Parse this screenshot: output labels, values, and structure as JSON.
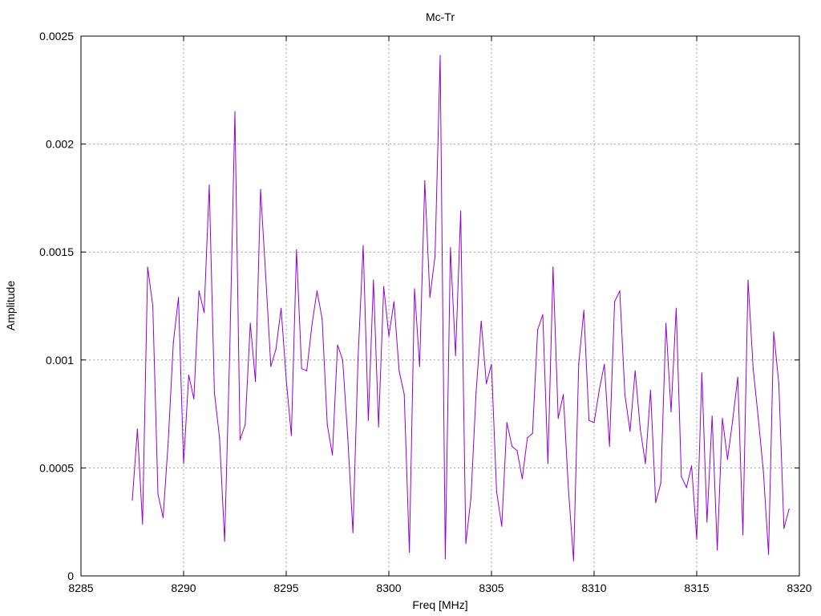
{
  "chart_data": {
    "type": "line",
    "title": "Mc-Tr",
    "xlabel": "Freq [MHz]",
    "ylabel": "Amplitude",
    "xlim": [
      8285,
      8320
    ],
    "ylim": [
      0,
      0.0025
    ],
    "grid": true,
    "xticks": [
      8285,
      8290,
      8295,
      8300,
      8305,
      8310,
      8315,
      8320
    ],
    "yticks": [
      0,
      0.0005,
      0.001,
      0.0015,
      0.002,
      0.0025
    ],
    "xtick_labels": [
      "8285",
      "8290",
      "8295",
      "8300",
      "8305",
      "8310",
      "8315",
      "8320"
    ],
    "ytick_labels": [
      "0",
      "0.0005",
      "0.001",
      "0.0015",
      "0.002",
      "0.0025"
    ],
    "line_color": "#9400d3",
    "series": [
      {
        "x": [
          8287.5,
          8287.75,
          8288.0,
          8288.25,
          8288.5,
          8288.75,
          8289.0,
          8289.25,
          8289.5,
          8289.75,
          8290.0,
          8290.25,
          8290.5,
          8290.75,
          8291.0,
          8291.25,
          8291.5,
          8291.75,
          8292.0,
          8292.25,
          8292.5,
          8292.75,
          8293.0,
          8293.25,
          8293.5,
          8293.75,
          8294.0,
          8294.25,
          8294.5,
          8294.75,
          8295.0,
          8295.25,
          8295.5,
          8295.75,
          8296.0,
          8296.25,
          8296.5,
          8296.75,
          8297.0,
          8297.25,
          8297.5,
          8297.75,
          8298.0,
          8298.25,
          8298.5,
          8298.75,
          8299.0,
          8299.25,
          8299.5,
          8299.75,
          8300.0,
          8300.25,
          8300.5,
          8300.75,
          8301.0,
          8301.25,
          8301.5,
          8301.75,
          8302.0,
          8302.25,
          8302.5,
          8302.75,
          8303.0,
          8303.25,
          8303.5,
          8303.75,
          8304.0,
          8304.25,
          8304.5,
          8304.75,
          8305.0,
          8305.25,
          8305.5,
          8305.75,
          8306.0,
          8306.25,
          8306.5,
          8306.75,
          8307.0,
          8307.25,
          8307.5,
          8307.75,
          8308.0,
          8308.25,
          8308.5,
          8308.75,
          8309.0,
          8309.25,
          8309.5,
          8309.75,
          8310.0,
          8310.25,
          8310.5,
          8310.75,
          8311.0,
          8311.25,
          8311.5,
          8311.75,
          8312.0,
          8312.25,
          8312.5,
          8312.75,
          8313.0,
          8313.25,
          8313.5,
          8313.75,
          8314.0,
          8314.25,
          8314.5,
          8314.75,
          8315.0,
          8315.25,
          8315.5,
          8315.75,
          8316.0,
          8316.25,
          8316.5,
          8316.75,
          8317.0,
          8317.25,
          8317.5,
          8317.75,
          8318.0,
          8318.25,
          8318.5,
          8318.75,
          8319.0,
          8319.25,
          8319.5
        ],
        "y": [
          0.00035,
          0.00068,
          0.00024,
          0.00143,
          0.00125,
          0.00038,
          0.00027,
          0.00062,
          0.00108,
          0.00129,
          0.00052,
          0.00093,
          0.00082,
          0.00132,
          0.00122,
          0.00181,
          0.00085,
          0.00064,
          0.00016,
          0.00105,
          0.00215,
          0.00063,
          0.0007,
          0.00117,
          0.0009,
          0.00179,
          0.00139,
          0.00097,
          0.00105,
          0.00124,
          0.00091,
          0.00065,
          0.00151,
          0.00096,
          0.00095,
          0.00116,
          0.00132,
          0.00119,
          0.0007,
          0.00056,
          0.00107,
          0.001,
          0.00064,
          0.0002,
          0.00101,
          0.00153,
          0.00072,
          0.00137,
          0.00069,
          0.00134,
          0.00111,
          0.00127,
          0.00095,
          0.00084,
          0.00011,
          0.00133,
          0.00097,
          0.00183,
          0.00129,
          0.00148,
          0.00241,
          8e-05,
          0.00152,
          0.00102,
          0.00169,
          0.00015,
          0.00036,
          0.00085,
          0.00118,
          0.00089,
          0.00098,
          0.00039,
          0.00023,
          0.00071,
          0.0006,
          0.00058,
          0.00045,
          0.00064,
          0.00066,
          0.00114,
          0.00121,
          0.00052,
          0.00143,
          0.00073,
          0.00084,
          0.0004,
          7e-05,
          0.00098,
          0.00123,
          0.00072,
          0.00071,
          0.00086,
          0.00098,
          0.0006,
          0.00127,
          0.00132,
          0.00084,
          0.00067,
          0.00095,
          0.00068,
          0.00052,
          0.00086,
          0.00034,
          0.00043,
          0.00117,
          0.00076,
          0.00124,
          0.00046,
          0.00041,
          0.00051,
          0.00017,
          0.00094,
          0.00025,
          0.00074,
          0.00012,
          0.00073,
          0.00054,
          0.00072,
          0.00092,
          0.00019,
          0.00137,
          0.00096,
          0.00073,
          0.00048,
          0.0001,
          0.00113,
          0.00089,
          0.00022,
          0.00031
        ]
      }
    ]
  }
}
